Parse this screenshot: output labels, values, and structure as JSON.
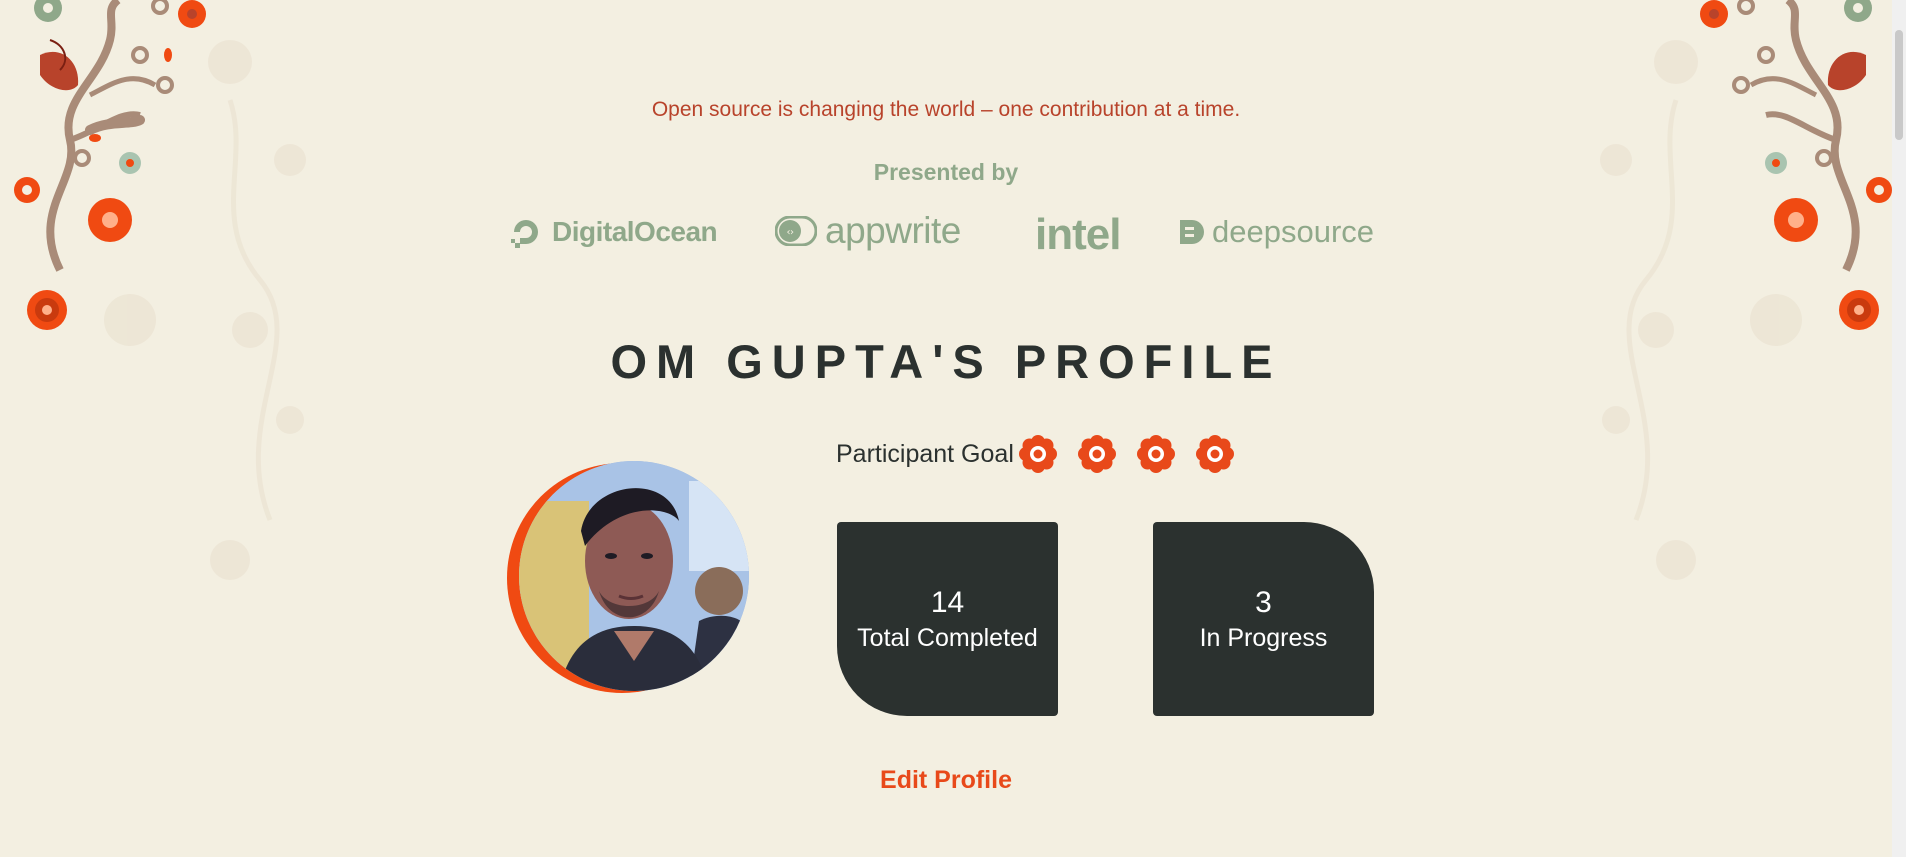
{
  "tagline": "Open source is changing the world – one contribution at a time.",
  "presented_by": "Presented by",
  "sponsors": {
    "digitalocean": "DigitalOcean",
    "appwrite": "appwrite",
    "intel": "intel",
    "deepsource": "deepsource"
  },
  "profile": {
    "title": "OM GUPTA'S PROFILE",
    "goal_label": "Participant Goal",
    "goal_count": 4
  },
  "stats": [
    {
      "value": "14",
      "label": "Total Completed"
    },
    {
      "value": "3",
      "label": "In Progress"
    }
  ],
  "edit_profile": "Edit Profile",
  "colors": {
    "background": "#f3efe1",
    "accent": "#e8491a",
    "dark": "#2b312f",
    "sage": "#8fa88a",
    "tagline": "#b8432b"
  }
}
